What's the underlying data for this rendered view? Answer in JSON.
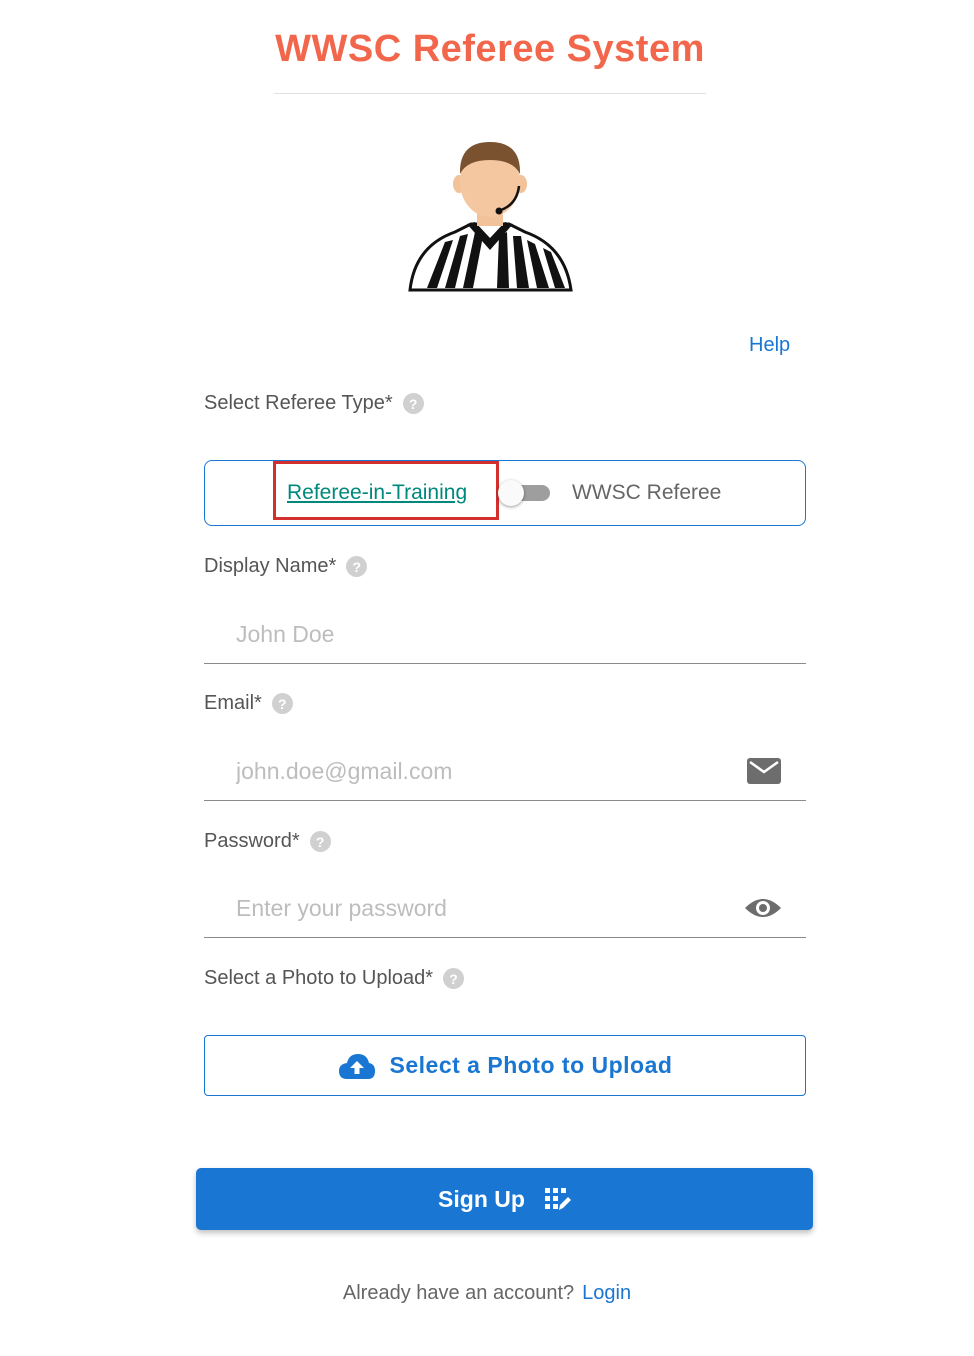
{
  "header": {
    "title": "WWSC Referee System"
  },
  "help_link": "Help",
  "referee_type": {
    "label": "Select Referee Type*",
    "option_left": "Referee-in-Training",
    "option_right": "WWSC Referee",
    "toggle_on": false
  },
  "display_name": {
    "label": "Display Name*",
    "placeholder": "John Doe",
    "value": ""
  },
  "email": {
    "label": "Email*",
    "placeholder": "john.doe@gmail.com",
    "value": "",
    "icon": "mail-icon"
  },
  "password": {
    "label": "Password*",
    "placeholder": "Enter your password",
    "value": "",
    "icon": "eye-icon"
  },
  "photo": {
    "label": "Select a Photo to Upload*",
    "button_label": "Select a Photo to Upload",
    "icon": "cloud-upload-icon"
  },
  "signup": {
    "button_label": "Sign Up",
    "icon": "draw-icon"
  },
  "footer": {
    "prompt": "Already have an account?",
    "login_label": "Login"
  },
  "help_icon_glyph": "?",
  "colors": {
    "title": "#f2674b",
    "primary": "#1976d2",
    "link_teal": "#00897b",
    "highlight": "#d32f2f"
  }
}
